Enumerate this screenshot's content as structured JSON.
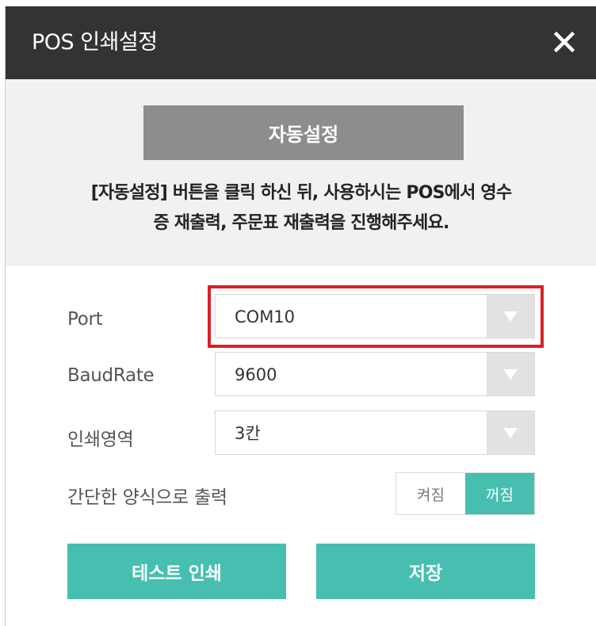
{
  "dialog": {
    "title": "POS 인쇄설정",
    "close_icon": "close-icon"
  },
  "auto_setup": {
    "button_label": "자동설정",
    "description_line1": "[자동설정] 버튼을 클릭 하신 뒤, 사용하시는 POS에서 영수",
    "description_line2": "증 재출력, 주문표 재출력을 진행해주세요."
  },
  "settings": {
    "port": {
      "label": "Port",
      "value": "COM10"
    },
    "baud_rate": {
      "label": "BaudRate",
      "value": "9600"
    },
    "print_area": {
      "label": "인쇄영역",
      "value": "3칸"
    },
    "simple_print": {
      "label": "간단한 양식으로 출력",
      "on_label": "켜짐",
      "off_label": "꺼짐",
      "selected": "꺼짐"
    }
  },
  "actions": {
    "test_print_label": "테스트 인쇄",
    "save_label": "저장"
  },
  "colors": {
    "header_bg": "#333333",
    "accent": "#46bfb0",
    "auto_button": "#8d8d8d",
    "highlight": "#d9202a"
  }
}
